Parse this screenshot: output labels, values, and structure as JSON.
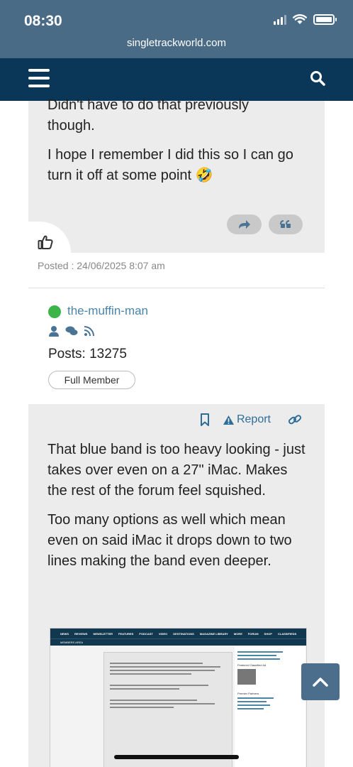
{
  "status_bar": {
    "time": "08:30",
    "url": "singletrackworld.com"
  },
  "nav": {
    "menu_icon": "hamburger-menu-icon",
    "search_icon": "search-icon"
  },
  "post1": {
    "lines": [
      "Didn't have to do that previously",
      "though."
    ],
    "para2": "I hope I remember I did this so I can go turn it off at some point 🤣",
    "posted": "Posted : 24/06/2025 8:07 am"
  },
  "author": {
    "name": "the-muffin-man",
    "posts": "Posts: 13275",
    "rank": "Full Member"
  },
  "post2": {
    "report_label": "Report",
    "para1": "That blue band is too heavy looking - just takes over even on a 27\" iMac. Makes the rest of the forum feel squished.",
    "para2": "Too many options as well which mean even on said iMac it drops down to two lines making the band even deeper."
  },
  "embedded_screenshot": {
    "nav_items": [
      "NEWS",
      "REVIEWS",
      "NEWSLETTER",
      "FEATURES",
      "PODCAST",
      "VIDEO",
      "DESTINATIONS",
      "MAGAZINE LIBRARY",
      "MORE",
      "FORUM",
      "SHOP",
      "CLASSIFIEDS"
    ],
    "nav2_items": [
      "MEMBERS AREA"
    ],
    "sidebar": [
      "Featured Classified Ad",
      "Premier Partners"
    ]
  },
  "colors": {
    "status_bar": "#4a6b86",
    "navbar": "#0a3657",
    "post_bg": "#ececec",
    "online": "#3bb54a",
    "link": "#2d6d9a",
    "username": "#4a84a8"
  }
}
